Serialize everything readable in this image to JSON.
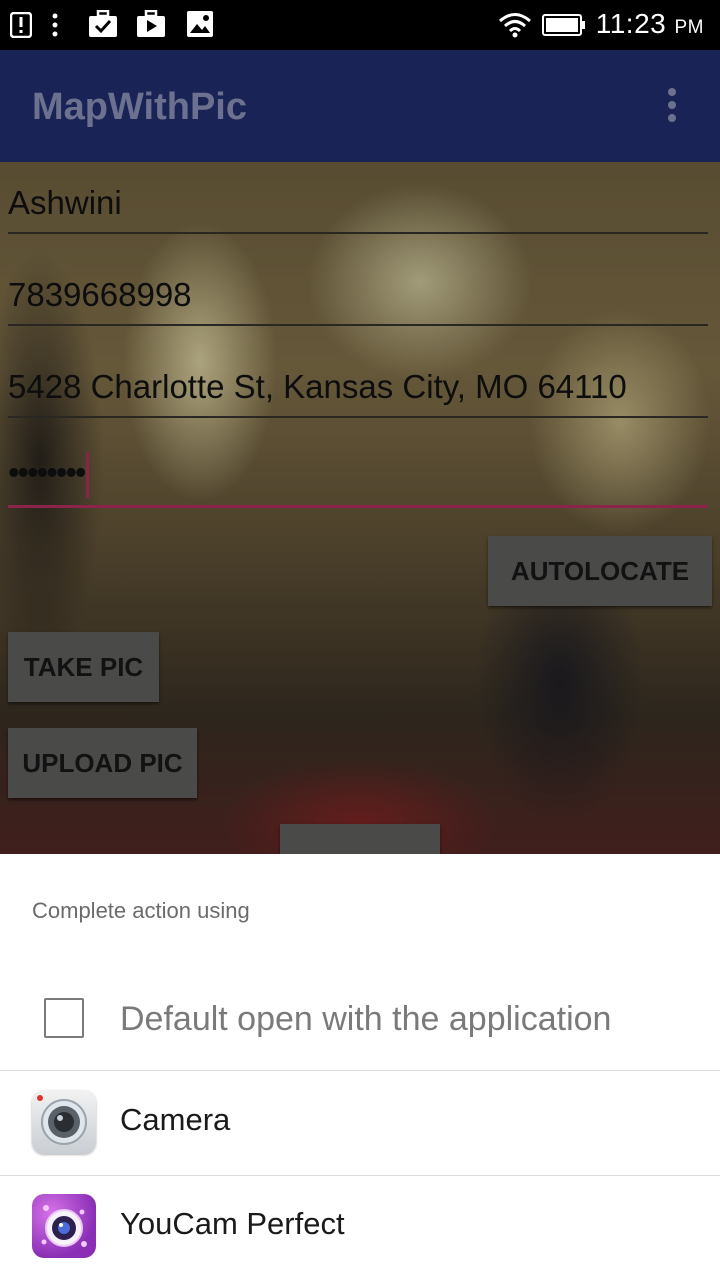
{
  "status_bar": {
    "time": "11:23",
    "ampm": "PM",
    "icons": [
      "alert-icon",
      "more-vert-icon",
      "briefcase-check-icon",
      "play-store-icon",
      "image-icon",
      "wifi-icon",
      "battery-icon"
    ]
  },
  "app_bar": {
    "title": "MapWithPic",
    "overflow_icon": "more-vert-icon"
  },
  "form": {
    "name": "Ashwini",
    "phone": "7839668998",
    "address": "5428 Charlotte St, Kansas City, MO 64110",
    "password": "••••••••"
  },
  "buttons": {
    "autolocate": "AUTOLOCATE",
    "take_pic": "TAKE PIC",
    "upload_pic": "UPLOAD PIC"
  },
  "sheet": {
    "title": "Complete action using",
    "default_label": "Default open with the application",
    "apps": [
      {
        "name": "Camera",
        "icon": "camera-app-icon"
      },
      {
        "name": "YouCam Perfect",
        "icon": "youcam-app-icon"
      }
    ]
  },
  "colors": {
    "app_bar": "#1a2356",
    "accent": "#8a2448",
    "button": "#4a4a48"
  }
}
